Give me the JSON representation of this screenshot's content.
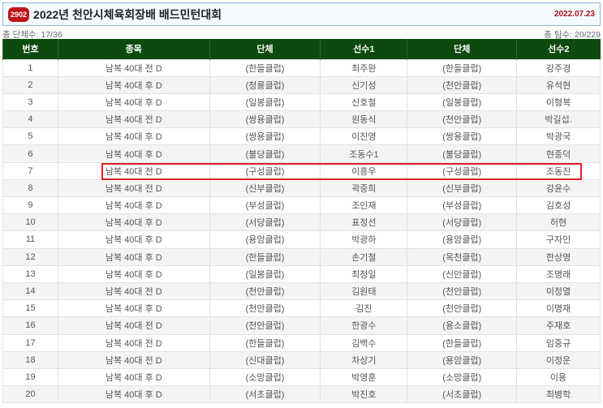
{
  "header": {
    "badge": "2902",
    "title": "2022년 천안시체육회장배 배드민턴대회",
    "date": "2022.07.23"
  },
  "stats": {
    "left": "총 단체수: 17/36",
    "right": "총 팀수: 20/229"
  },
  "columns": [
    "번호",
    "종목",
    "단체",
    "선수1",
    "단체",
    "선수2"
  ],
  "highlighted_row": 7,
  "colors": {
    "header_bg": "#0d4a0d",
    "highlight": "#e0202a",
    "badge": "#c0141c"
  },
  "rows": [
    [
      "1",
      "남복 40대 전 D",
      "(한들클럽)",
      "최주완",
      "(한들클럽)",
      "강주경"
    ],
    [
      "2",
      "남복 40대 후 D",
      "(청룡클럽)",
      "신기성",
      "(천안클럽)",
      "유석현"
    ],
    [
      "3",
      "남복 40대 후 D",
      "(일봉클럽)",
      "신호철",
      "(일봉클럽)",
      "이형복"
    ],
    [
      "4",
      "남복 40대 전 D",
      "(쌍용클럽)",
      "원동식",
      "(천안클럽)",
      "박길섭."
    ],
    [
      "5",
      "남복 40대 후 D",
      "(쌍용클럽)",
      "이진영",
      "(쌍용클럽)",
      "박광국"
    ],
    [
      "6",
      "남복 40대 후 D",
      "(불당클럽)",
      "조동수1",
      "(불당클럽)",
      "현종덕"
    ],
    [
      "7",
      "남복 40대 전 D",
      "(구성클럽)",
      "이흥우",
      "(구성클럽)",
      "조동진"
    ],
    [
      "8",
      "남복 40대 전 D",
      "(신부클럽)",
      "곽중희",
      "(신부클럽)",
      "강윤수"
    ],
    [
      "9",
      "남복 40대 후 D",
      "(부성클럽)",
      "조인재",
      "(부성클럽)",
      "김호성"
    ],
    [
      "10",
      "남복 40대 후 D",
      "(서당클럽)",
      "표정선",
      "(서당클럽)",
      "허현"
    ],
    [
      "11",
      "남복 40대 후 D",
      "(용암클럽)",
      "박광하",
      "(용암클럽)",
      "구자인"
    ],
    [
      "12",
      "남복 40대 후 D",
      "(한들클럽)",
      "손기철",
      "(목천클럽)",
      "한상영"
    ],
    [
      "13",
      "남복 40대 후 D",
      "(일봉클럽)",
      "최정일",
      "(신안클럽)",
      "조명래"
    ],
    [
      "14",
      "남복 40대 전 D",
      "(천안클럽)",
      "김원태",
      "(천안클럽)",
      "이정열"
    ],
    [
      "15",
      "남복 40대 후 D",
      "(천안클럽)",
      "김진",
      "(천안클럽)",
      "이명재"
    ],
    [
      "16",
      "남복 40대 전 D",
      "(천안클럽)",
      "한광수",
      "(용소클럽)",
      "주재호"
    ],
    [
      "17",
      "남복 40대 전 D",
      "(한들클럽)",
      "김백수",
      "(한들클럽)",
      "임중규"
    ],
    [
      "18",
      "남복 40대 전 D",
      "(신대클럽)",
      "차상기",
      "(용암클럽)",
      "이정운"
    ],
    [
      "19",
      "남복 40대 후 D",
      "(소망클럽)",
      "박영훈",
      "(소망클럽)",
      "이용"
    ],
    [
      "20",
      "남복 40대 후 D",
      "(서초클럽)",
      "박진호",
      "(서초클럽)",
      "최병학"
    ]
  ]
}
